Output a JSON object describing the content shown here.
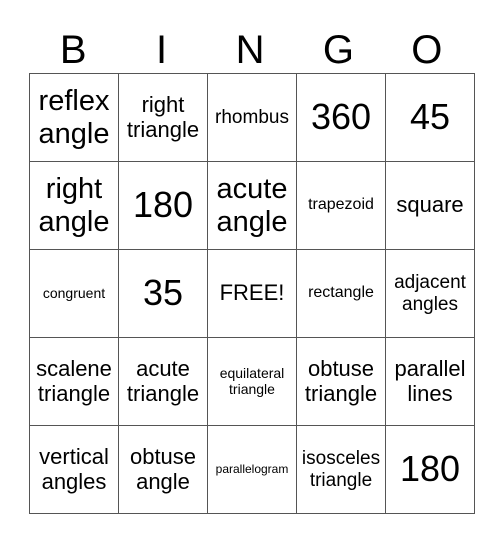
{
  "header": [
    "B",
    "I",
    "N",
    "G",
    "O"
  ],
  "rows": [
    [
      "reflex angle",
      "right triangle",
      "rhombus",
      "360",
      "45"
    ],
    [
      "right angle",
      "180",
      "acute angle",
      "trapezoid",
      "square"
    ],
    [
      "congruent",
      "35",
      "FREE!",
      "rectangle",
      "adjacent angles"
    ],
    [
      "scalene triangle",
      "acute triangle",
      "equilateral triangle",
      "obtuse triangle",
      "parallel lines"
    ],
    [
      "vertical angles",
      "obtuse angle",
      "parallelogram",
      "isosceles triangle",
      "180"
    ]
  ]
}
